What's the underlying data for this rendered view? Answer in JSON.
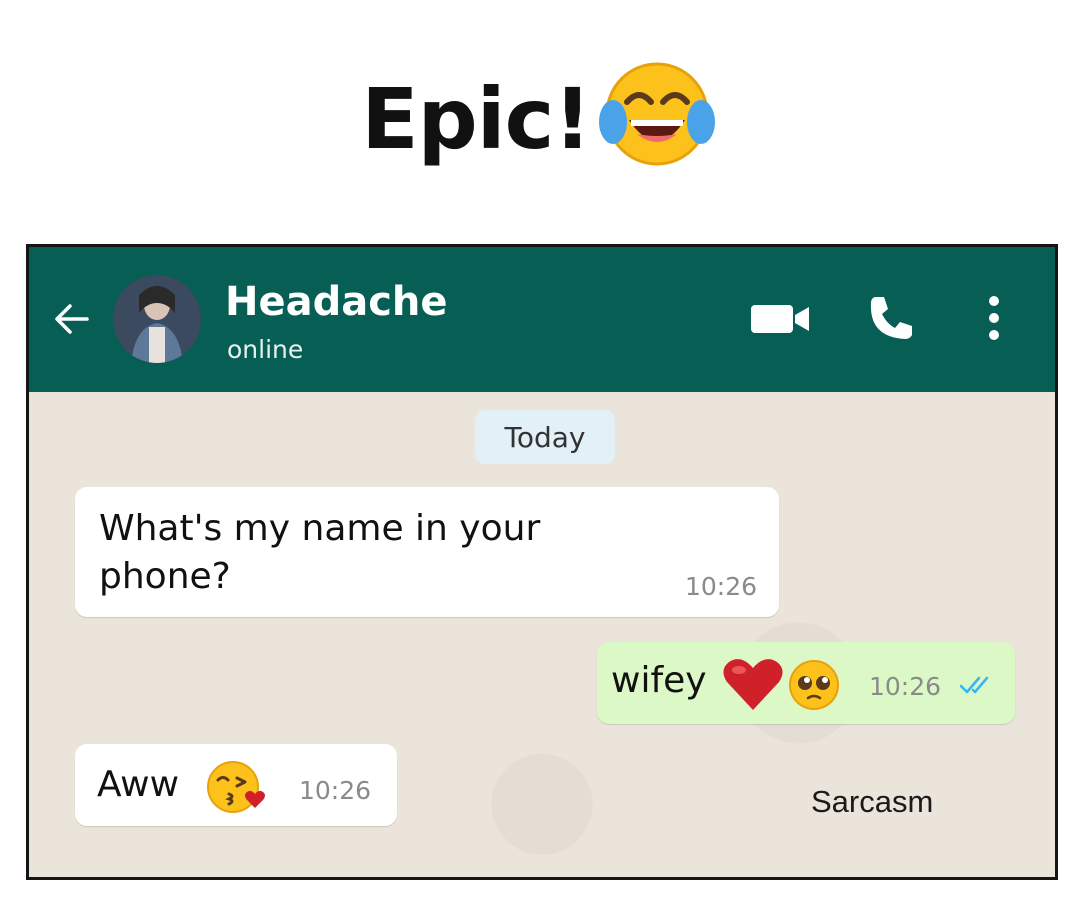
{
  "caption": {
    "text": "Epic!",
    "emoji": "face-with-tears-of-joy-icon"
  },
  "header": {
    "contact_name": "Headache",
    "status": "online",
    "color": "#075e54",
    "icons": [
      "back-arrow-icon",
      "video-call-icon",
      "phone-call-icon",
      "more-options-icon"
    ]
  },
  "chat": {
    "date_chip": "Today",
    "messages": [
      {
        "direction": "incoming",
        "text": "What's my name in your phone?",
        "time": "10:26"
      },
      {
        "direction": "outgoing",
        "text": "wifey",
        "emojis": [
          "red-heart-icon",
          "pleading-face-icon"
        ],
        "time": "10:26",
        "status": "read"
      },
      {
        "direction": "incoming",
        "text": "Aww",
        "emojis": [
          "kissing-face-icon"
        ],
        "time": "10:26"
      }
    ],
    "incoming_bubble_color": "#ffffff",
    "outgoing_bubble_color": "#dcf8c6",
    "read_tick_color": "#34b7f1"
  },
  "watermark": "Sarcasm"
}
